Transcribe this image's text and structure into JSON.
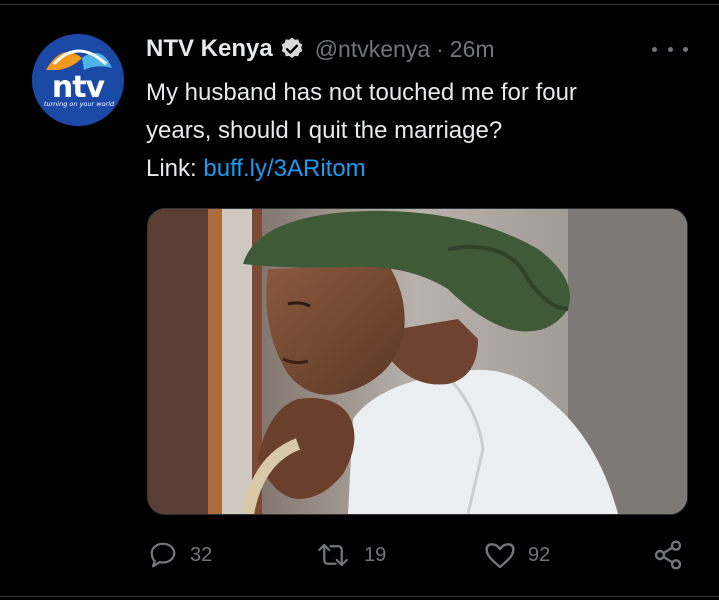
{
  "tweet": {
    "author": {
      "display_name": "NTV Kenya",
      "handle": "@ntvkenya",
      "verified": true,
      "avatar": {
        "wordmark": "ntv",
        "tagline": "turning on your world",
        "colors": {
          "background": "#1a4aa5",
          "accent_orange": "#f39a1e",
          "accent_blue": "#4fb4e6"
        }
      }
    },
    "separator": "·",
    "timestamp": "26m",
    "text_line_1": "My husband has not touched me for four",
    "text_line_2": "years, should I quit the marriage?",
    "link_label": "Link:",
    "link_url": "buff.ly/3ARitom",
    "media": {
      "description_icon": "photo-woman-green-headscarf"
    },
    "actions": {
      "reply_count": "32",
      "retweet_count": "19",
      "like_count": "92"
    }
  },
  "colors": {
    "background": "#000000",
    "text_primary": "#e7e9ea",
    "text_secondary": "#71767b",
    "link": "#1d9bf0",
    "verified_badge": "#d9d9d9"
  }
}
